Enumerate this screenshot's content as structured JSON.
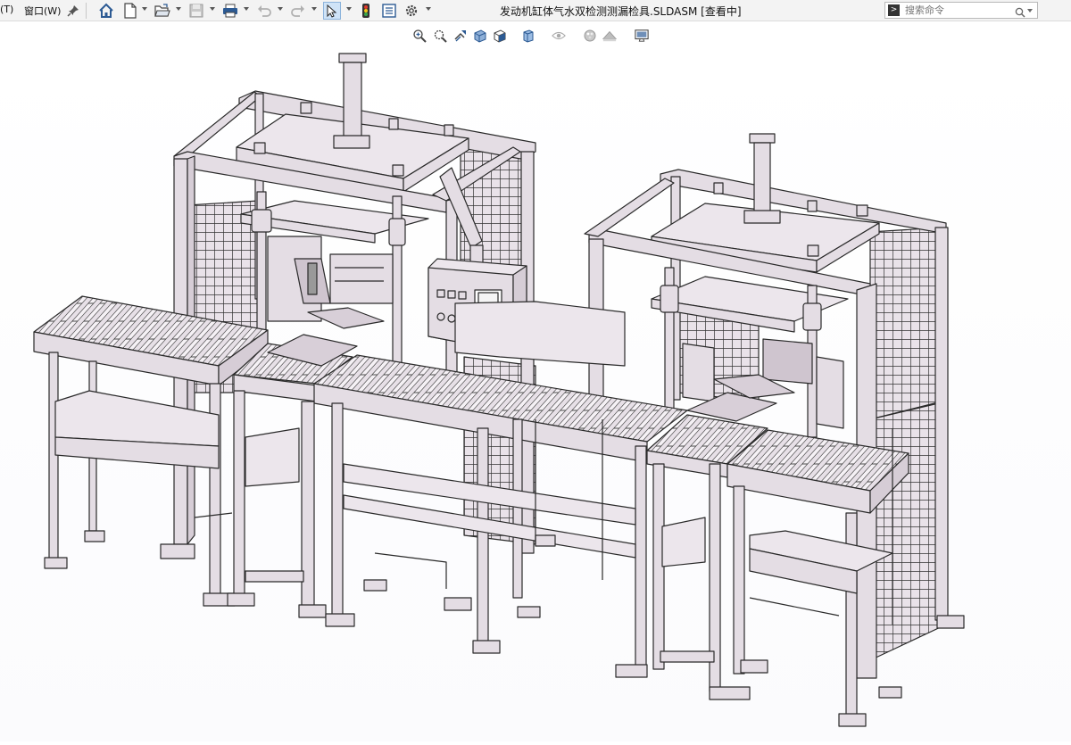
{
  "menu": {
    "items": [
      {
        "label": "(T)"
      },
      {
        "label": "窗口(W)"
      }
    ]
  },
  "window": {
    "title": "发动机缸体气水双检测测漏检具.SLDASM [查看中]"
  },
  "toolbar": {
    "icons": [
      "pin-icon",
      "home-icon",
      "new-document-icon",
      "open-folder-icon",
      "save-icon",
      "print-icon",
      "undo-icon",
      "redo-icon",
      "select-cursor-icon",
      "traffic-light-icon",
      "file-properties-icon",
      "options-gear-icon"
    ]
  },
  "search": {
    "placeholder": "搜索命令"
  },
  "heads_up_toolbar": {
    "icons": [
      "zoom-to-fit-icon",
      "zoom-to-area-icon",
      "previous-view-icon",
      "section-view-icon",
      "view-orientation-icon",
      "display-style-icon",
      "hide-show-items-icon",
      "edit-appearance-icon",
      "apply-scene-icon",
      "view-settings-icon"
    ]
  },
  "model": {
    "name": "engine-block-leak-test-fixture",
    "color": "#e4dde4",
    "edge_color": "#2a2a2a"
  }
}
